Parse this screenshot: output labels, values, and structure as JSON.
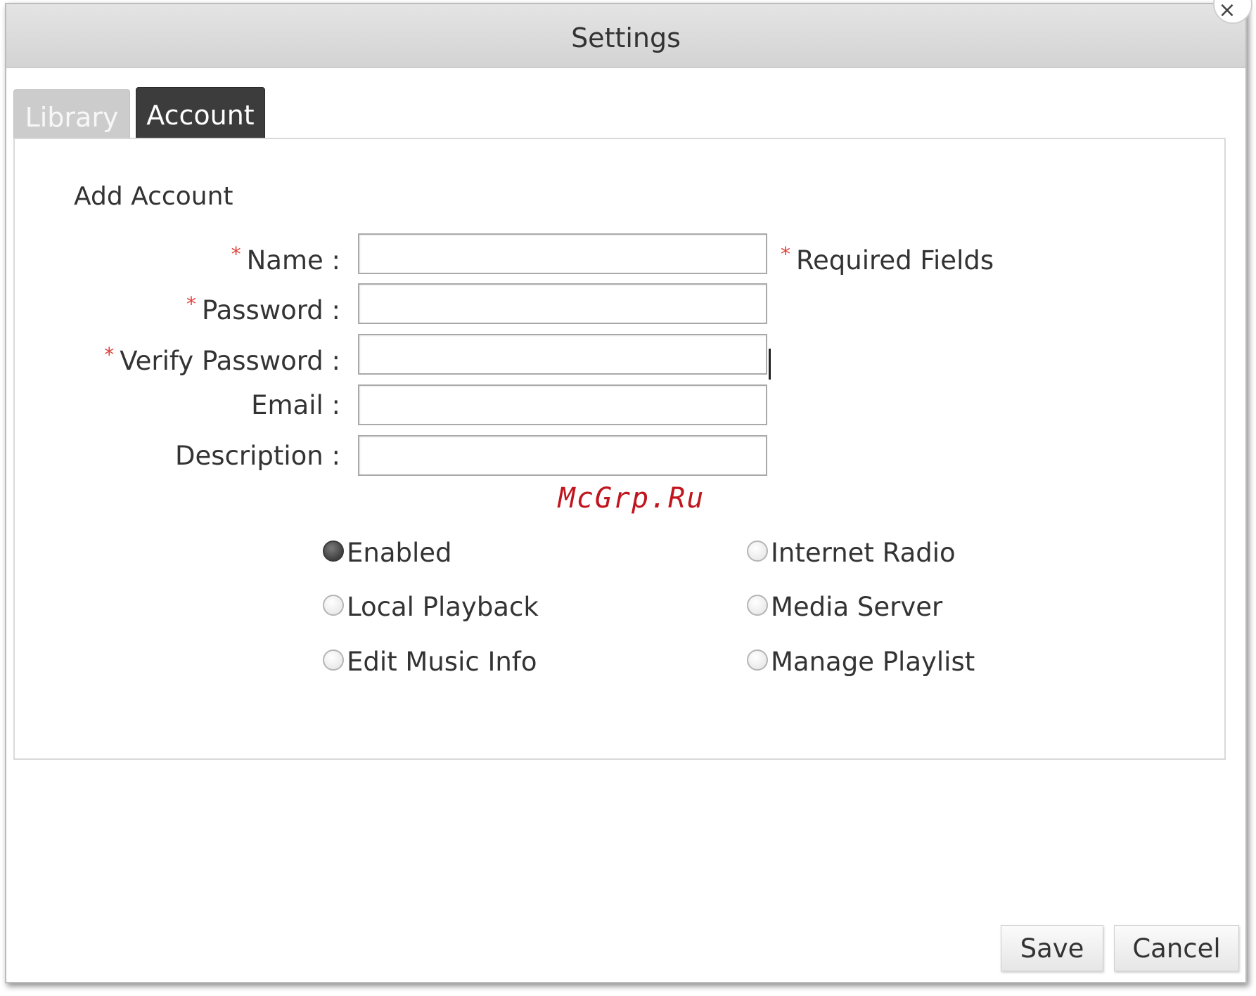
{
  "dialog": {
    "title": "Settings",
    "close_glyph": "×"
  },
  "tabs": [
    {
      "label": "Library",
      "active": false
    },
    {
      "label": "Account",
      "active": true
    }
  ],
  "form": {
    "section_title": "Add Account",
    "required_mark": "*",
    "required_note": "Required Fields",
    "fields": {
      "name": {
        "label": "Name :",
        "required": true,
        "value": ""
      },
      "password": {
        "label": "Password :",
        "required": true,
        "value": ""
      },
      "verify_password": {
        "label": "Verify Password :",
        "required": true,
        "value": ""
      },
      "email": {
        "label": "Email :",
        "required": false,
        "value": ""
      },
      "description": {
        "label": "Description :",
        "required": false,
        "value": ""
      }
    },
    "options": [
      {
        "label": "Enabled",
        "selected": true
      },
      {
        "label": "Internet Radio",
        "selected": false
      },
      {
        "label": "Local Playback",
        "selected": false
      },
      {
        "label": "Media Server",
        "selected": false
      },
      {
        "label": "Edit Music Info",
        "selected": false
      },
      {
        "label": "Manage Playlist",
        "selected": false
      }
    ]
  },
  "watermark": "McGrp.Ru",
  "buttons": {
    "save": "Save",
    "cancel": "Cancel"
  },
  "colors": {
    "required_mark": "#e0413a",
    "watermark": "#c0161e",
    "active_tab": "#3c3c3c",
    "inactive_tab": "#cccccc"
  }
}
